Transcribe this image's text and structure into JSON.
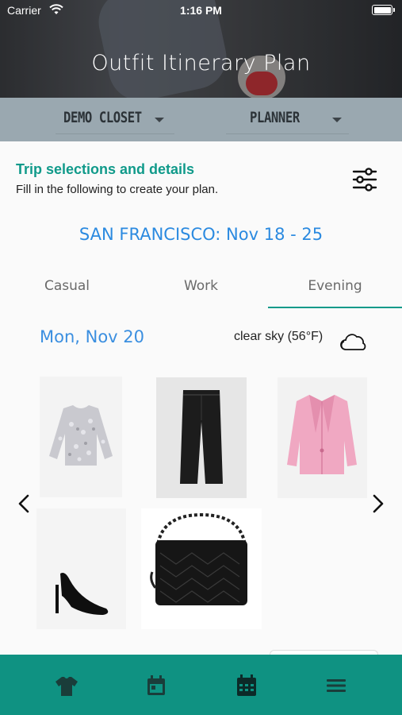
{
  "status_bar": {
    "carrier": "Carrier",
    "time": "1:16 PM"
  },
  "app_title": "Outfit Itinerary Plan",
  "selectors": {
    "closet": "DEMO CLOSET",
    "mode": "PLANNER"
  },
  "section": {
    "title": "Trip selections and details",
    "subtitle": "Fill in the following to create your plan."
  },
  "trip": {
    "title": "SAN FRANCISCO: Nov 18 - 25"
  },
  "tabs": [
    {
      "label": "Casual",
      "active": false
    },
    {
      "label": "Work",
      "active": false
    },
    {
      "label": "Evening",
      "active": true
    }
  ],
  "day": {
    "label": "Mon,  Nov 20",
    "weather": "clear sky (56°F)"
  },
  "outfit_items": [
    {
      "name": "sequin-top-image"
    },
    {
      "name": "black-trousers-image"
    },
    {
      "name": "pink-blazer-image"
    },
    {
      "name": "black-heels-image"
    },
    {
      "name": "black-quilted-bag-image"
    }
  ],
  "icons": {
    "filter": "sliders-icon",
    "weather": "cloud-icon",
    "prev": "chevron-left-icon",
    "next": "chevron-right-icon",
    "tab_closet": "shirt-icon",
    "tab_calendar": "calendar-icon",
    "tab_planner": "calendar-grid-icon",
    "tab_menu": "menu-icon"
  },
  "colors": {
    "accent": "#109a8a",
    "link_blue": "#2b8ae0",
    "selector_bar": "#9aa8b0",
    "tabbar": "#0f9282"
  }
}
